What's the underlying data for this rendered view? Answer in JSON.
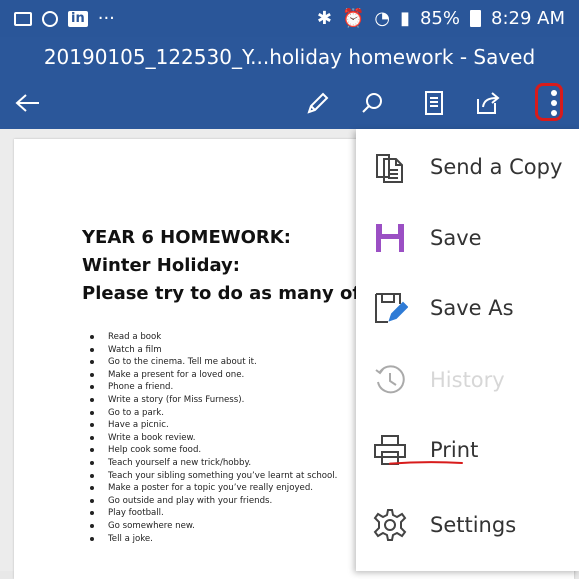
{
  "status_bar": {
    "left_dots": "···",
    "battery_percent": "85%",
    "time": "8:29 AM",
    "app_icons": [
      "message-icon",
      "whatsapp-icon",
      "linkedin-icon"
    ],
    "linkedin_label": "in"
  },
  "title_bar": {
    "title": "20190105_122530_Y...holiday homework - Saved"
  },
  "toolbar": {
    "icons": [
      "back-arrow-icon",
      "pen-icon",
      "search-icon",
      "reading-view-icon",
      "share-icon",
      "more-options-icon"
    ]
  },
  "document": {
    "heading1": "YEAR 6 HOMEWORK:",
    "heading2": "Winter Holiday:",
    "heading3": "Please try to do as many of thes",
    "list": [
      "Read a book",
      "Watch a film",
      " Go to the cinema. Tell me about it.",
      "Make a present for a loved one.",
      "Phone a friend.",
      "Write a story (for Miss Furness).",
      "Go to a park.",
      "Have a picnic.",
      "Write a book review.",
      "Help cook some food.",
      "Teach yourself a new trick/hobby.",
      "Teach your sibling something you’ve learnt at school.",
      "Make a poster for a topic you’ve really enjoyed.",
      "Go outside and play with your friends.",
      "Play football.",
      "Go somewhere new.",
      "Tell a joke."
    ]
  },
  "menu": {
    "items": [
      {
        "label": "Send a Copy",
        "icon": "send-copy-icon",
        "enabled": true
      },
      {
        "label": "Save",
        "icon": "save-icon",
        "enabled": true
      },
      {
        "label": "Save As",
        "icon": "save-as-icon",
        "enabled": true
      },
      {
        "label": "History",
        "icon": "history-icon",
        "enabled": false
      },
      {
        "label": "Print",
        "icon": "print-icon",
        "enabled": true
      },
      {
        "label": "Settings",
        "icon": "settings-icon",
        "enabled": true
      }
    ]
  },
  "colors": {
    "header_blue": "#2b579a",
    "annotation_red": "#d81b1b",
    "save_purple": "#9b4fc4",
    "save_as_blue": "#2e7bd6"
  }
}
